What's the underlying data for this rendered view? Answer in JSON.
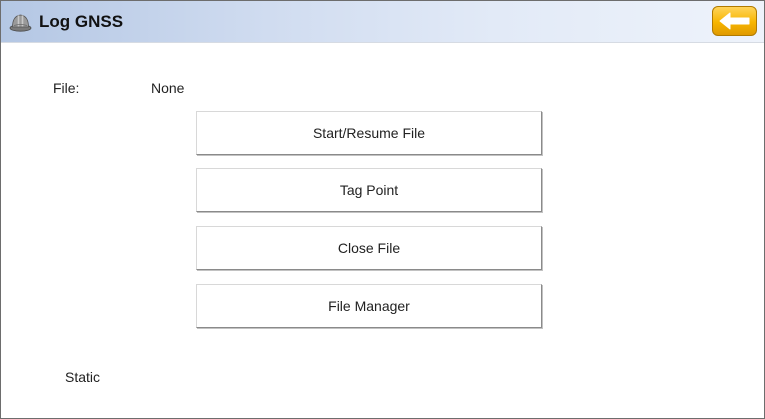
{
  "window": {
    "title": "Log GNSS",
    "icon": "hard-hat-icon",
    "back_icon": "back-arrow-icon"
  },
  "file": {
    "label": "File:",
    "value": "None"
  },
  "buttons": {
    "start_resume": "Start/Resume File",
    "tag_point": "Tag Point",
    "close_file": "Close File",
    "file_manager": "File Manager"
  },
  "status": {
    "mode": "Static"
  },
  "colors": {
    "titlebar_start": "#b4c7e4",
    "titlebar_end": "#eef3fb",
    "back_button": "#f7b500",
    "text": "#222222"
  }
}
